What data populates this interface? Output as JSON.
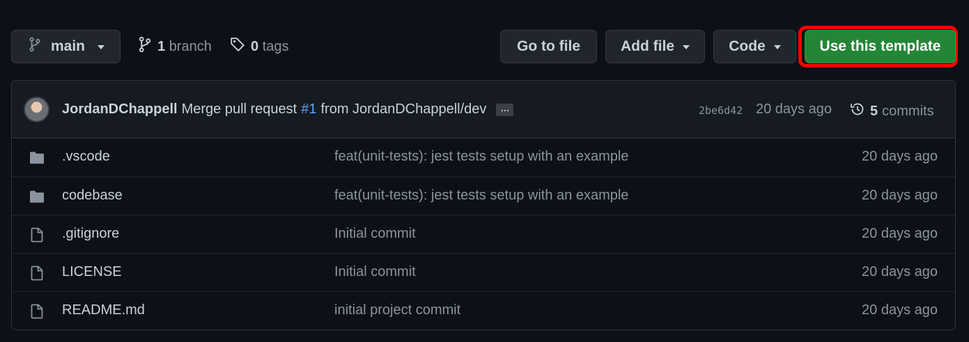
{
  "toolbar": {
    "branch_label": "main",
    "branch_count": "1",
    "branch_word": "branch",
    "tag_count": "0",
    "tag_word": "tags",
    "go_to_file": "Go to file",
    "add_file": "Add file",
    "code": "Code",
    "use_template": "Use this template"
  },
  "latest_commit": {
    "author": "JordanDChappell",
    "message_prefix": "Merge pull request",
    "pr": "#1",
    "message_suffix": "from JordanDChappell/dev",
    "ellipsis": "…",
    "sha": "2be6d42",
    "age": "20 days ago",
    "commit_count": "5",
    "commit_word": "commits"
  },
  "files": [
    {
      "name": ".vscode",
      "type": "folder",
      "message": "feat(unit-tests): jest tests setup with an example",
      "age": "20 days ago"
    },
    {
      "name": "codebase",
      "type": "folder",
      "message": "feat(unit-tests): jest tests setup with an example",
      "age": "20 days ago"
    },
    {
      "name": ".gitignore",
      "type": "file",
      "message": "Initial commit",
      "age": "20 days ago"
    },
    {
      "name": "LICENSE",
      "type": "file",
      "message": "Initial commit",
      "age": "20 days ago"
    },
    {
      "name": "README.md",
      "type": "file",
      "message": "initial project commit",
      "age": "20 days ago"
    }
  ],
  "colors": {
    "background": "#0d1117",
    "primary_button": "#238636",
    "highlight_outline": "#ff0000",
    "link": "#58a6ff"
  }
}
